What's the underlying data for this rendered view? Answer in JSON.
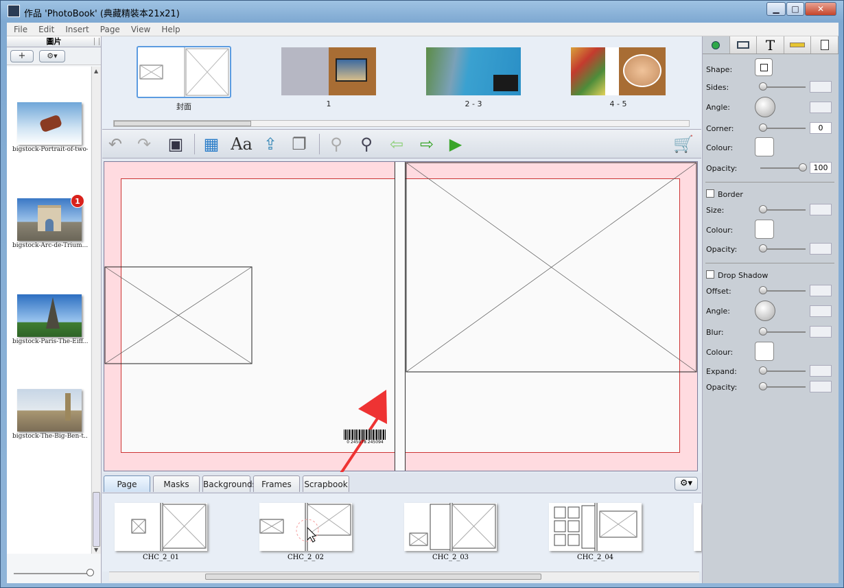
{
  "window": {
    "title": "作品 'PhotoBook' (典藏精裝本21x21)",
    "minimize": "▁",
    "maximize": "□",
    "close": "✕"
  },
  "menu": [
    "File",
    "Edit",
    "Insert",
    "Page",
    "View",
    "Help"
  ],
  "left_panel": {
    "header": "圖片",
    "add_label": "+",
    "gear_label": "⚙▾",
    "photos": [
      {
        "caption": "bigstock-Portrait-of-two-..."
      },
      {
        "caption": "bigstock-Arc-de-Trium...",
        "badge": "1"
      },
      {
        "caption": "bigstock-Paris-The-Eiff..."
      },
      {
        "caption": "bigstock-The-Big-Ben-t..."
      }
    ]
  },
  "pages": [
    {
      "label": "封面"
    },
    {
      "label": "1"
    },
    {
      "label": "2 - 3"
    },
    {
      "label": "4 - 5"
    }
  ],
  "barcode_text": "0 245078 245094",
  "tabs": [
    "Page Styles",
    "Masks",
    "Backgrounds",
    "Frames",
    "Scrapbook"
  ],
  "styles": [
    {
      "label": "CHC_2_01"
    },
    {
      "label": "CHC_2_02"
    },
    {
      "label": "CHC_2_03"
    },
    {
      "label": "CHC_2_04"
    }
  ],
  "properties": {
    "shape": "Shape:",
    "sides": "Sides:",
    "angle": "Angle:",
    "corner": "Corner:",
    "corner_value": "0",
    "colour": "Colour:",
    "opacity": "Opacity:",
    "opacity_value": "100",
    "border": "Border",
    "size": "Size:",
    "border_colour": "Colour:",
    "border_opacity": "Opacity:",
    "drop_shadow": "Drop Shadow",
    "offset": "Offset:",
    "shadow_angle": "Angle:",
    "blur": "Blur:",
    "shadow_colour": "Colour:",
    "expand": "Expand:",
    "shadow_opacity": "Opacity:"
  }
}
